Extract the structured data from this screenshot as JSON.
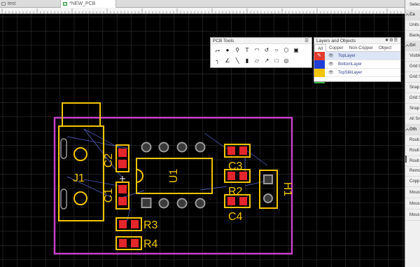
{
  "tabs": [
    {
      "label": "test",
      "active": false
    },
    {
      "label": "*NEW_PCB",
      "active": true
    }
  ],
  "pcb_tools": {
    "title": "PCB Tools",
    "menu_icon": "hamburger-icon",
    "row1": [
      "route-track",
      "via",
      "pad",
      "text",
      "arc",
      "circle-arc",
      "circle",
      "solid-region",
      "image"
    ],
    "row2": [
      "line",
      "dimension",
      "connect-pad",
      "copper-area",
      "square",
      "measure",
      "hole",
      "photo"
    ],
    "row1_glyphs": [
      "⮣",
      "●",
      "⚲",
      "T",
      "◠",
      "↺",
      "○",
      "⬡",
      "▣"
    ],
    "row2_glyphs": [
      "┐",
      "∠",
      "╲",
      "▮",
      "▱",
      "↗",
      "□",
      "◎",
      "▣"
    ]
  },
  "layers_panel": {
    "title": "Layers and Objects",
    "tabs": [
      "All",
      "Copper",
      "Non-Copper",
      "Object"
    ],
    "active_tab": "All",
    "rows": [
      {
        "name": "TopLayer",
        "color": "#e33b2f",
        "selected": true,
        "pen_icon": true
      },
      {
        "name": "BottomLayer",
        "color": "#1f3fd8",
        "selected": false
      },
      {
        "name": "TopSilkLayer",
        "color": "#f2c500",
        "selected": false
      }
    ],
    "next_row_color": "#3bb53b"
  },
  "right_panel": {
    "items": [
      {
        "label": "Selec",
        "section": false
      },
      {
        "label": "Ca",
        "section": true
      },
      {
        "label": "Units",
        "section": false
      },
      {
        "label": "Backg",
        "section": false
      },
      {
        "label": "Gri",
        "section": true
      },
      {
        "label": "Visible",
        "section": false
      },
      {
        "label": "Grid C",
        "section": false
      },
      {
        "label": "Grid S",
        "section": false
      },
      {
        "label": "Snap",
        "section": false
      },
      {
        "label": "Grid S",
        "section": false
      },
      {
        "label": "Snap",
        "section": false
      },
      {
        "label": "All Sn",
        "section": false
      },
      {
        "label": "Oth",
        "section": true
      },
      {
        "label": "Routi",
        "section": false
      },
      {
        "label": "Routi",
        "section": false
      },
      {
        "label": "Routi",
        "section": false
      },
      {
        "label": "Remo",
        "section": false
      },
      {
        "label": "Copp",
        "section": false
      },
      {
        "label": "Mous",
        "section": false
      },
      {
        "label": "Mous",
        "section": false
      },
      {
        "label": "Mous",
        "section": false
      }
    ]
  },
  "designators": {
    "j1": "J1",
    "u1": "U1",
    "c1": "C1",
    "c2": "C2",
    "c3": "C3",
    "c4": "C4",
    "r2": "R2",
    "r3": "R3",
    "r4": "R4",
    "h1": "H1"
  },
  "colors": {
    "silk": "#f2c500",
    "pad": "#e3262b",
    "outline": "#c83fc8",
    "multilayer": "#9a9a9a",
    "ratsnest": "#5f6ad8",
    "grid": "#2b2b2b"
  }
}
